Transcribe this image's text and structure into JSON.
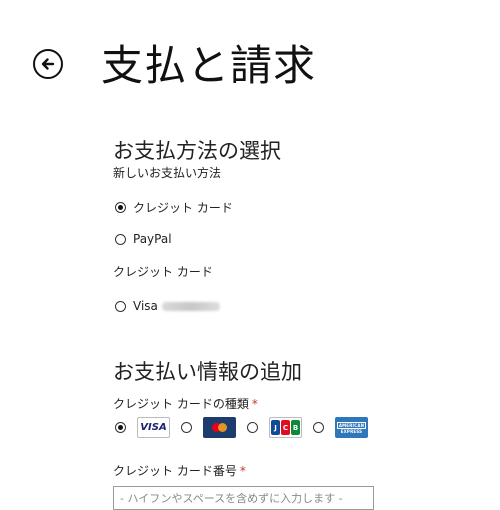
{
  "header": {
    "title": "支払と請求",
    "back_icon": "back-arrow-circle-icon"
  },
  "payment_method": {
    "section_title": "お支払方法の選択",
    "new_method_label": "新しいお支払い方法",
    "options": [
      {
        "label": "クレジット カード",
        "selected": true
      },
      {
        "label": "PayPal",
        "selected": false
      }
    ],
    "saved_cards_label": "クレジット カード",
    "saved_card": {
      "label": "Visa",
      "selected": false
    }
  },
  "payment_info": {
    "section_title": "お支払い情報の追加",
    "card_type_label": "クレジット カードの種類",
    "required_mark": "*",
    "card_types": [
      {
        "name": "VISA",
        "icon": "visa-logo",
        "selected": true
      },
      {
        "name": "MasterCard",
        "icon": "mastercard-logo",
        "selected": false
      },
      {
        "name": "JCB",
        "icon": "jcb-logo",
        "selected": false
      },
      {
        "name": "American Express",
        "icon": "amex-logo",
        "selected": false
      }
    ],
    "card_number_label": "クレジット カード番号",
    "card_number_placeholder": "- ハイフンやスペースを含めずに入力します -"
  },
  "colors": {
    "required": "#c0392b",
    "visa_blue": "#1a1f71",
    "mastercard_bg": "#1c3c6e",
    "amex_blue": "#2e77bb"
  }
}
